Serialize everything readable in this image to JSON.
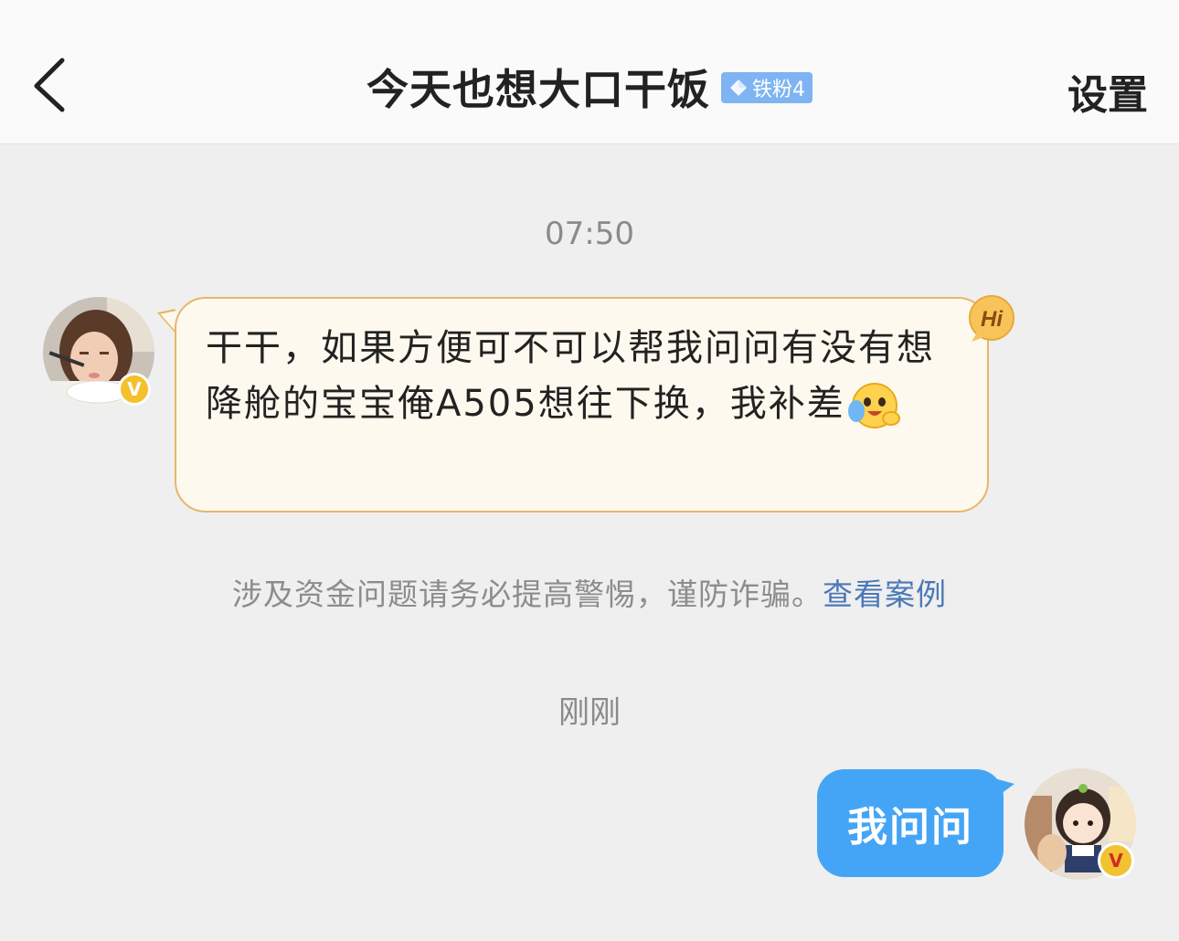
{
  "header": {
    "title": "今天也想大口干饭",
    "badge_label": "铁粉4",
    "settings_label": "设置",
    "back_icon": "chevron-left-icon"
  },
  "messages": {
    "time_first": "07:50",
    "incoming_text": "干干，如果方便可不可以帮我问问有没有想降舱的宝宝俺A505想往下换，我补差",
    "incoming_emoji": "hugging-face-emoji",
    "hi_badge_label": "Hi",
    "warning_text": "涉及资金问题请务必提高警惕，谨防诈骗。",
    "warning_link": "查看案例",
    "time_second": "刚刚",
    "outgoing_text": "我问问"
  },
  "colors": {
    "header_bg": "#fafafa",
    "page_bg": "#efefef",
    "incoming_bubble_bg": "#fdf9ee",
    "incoming_bubble_border": "#e6b66a",
    "outgoing_bubble_bg": "#44a5f6",
    "badge_bg": "#7fb4f2",
    "link": "#4a78b8"
  }
}
